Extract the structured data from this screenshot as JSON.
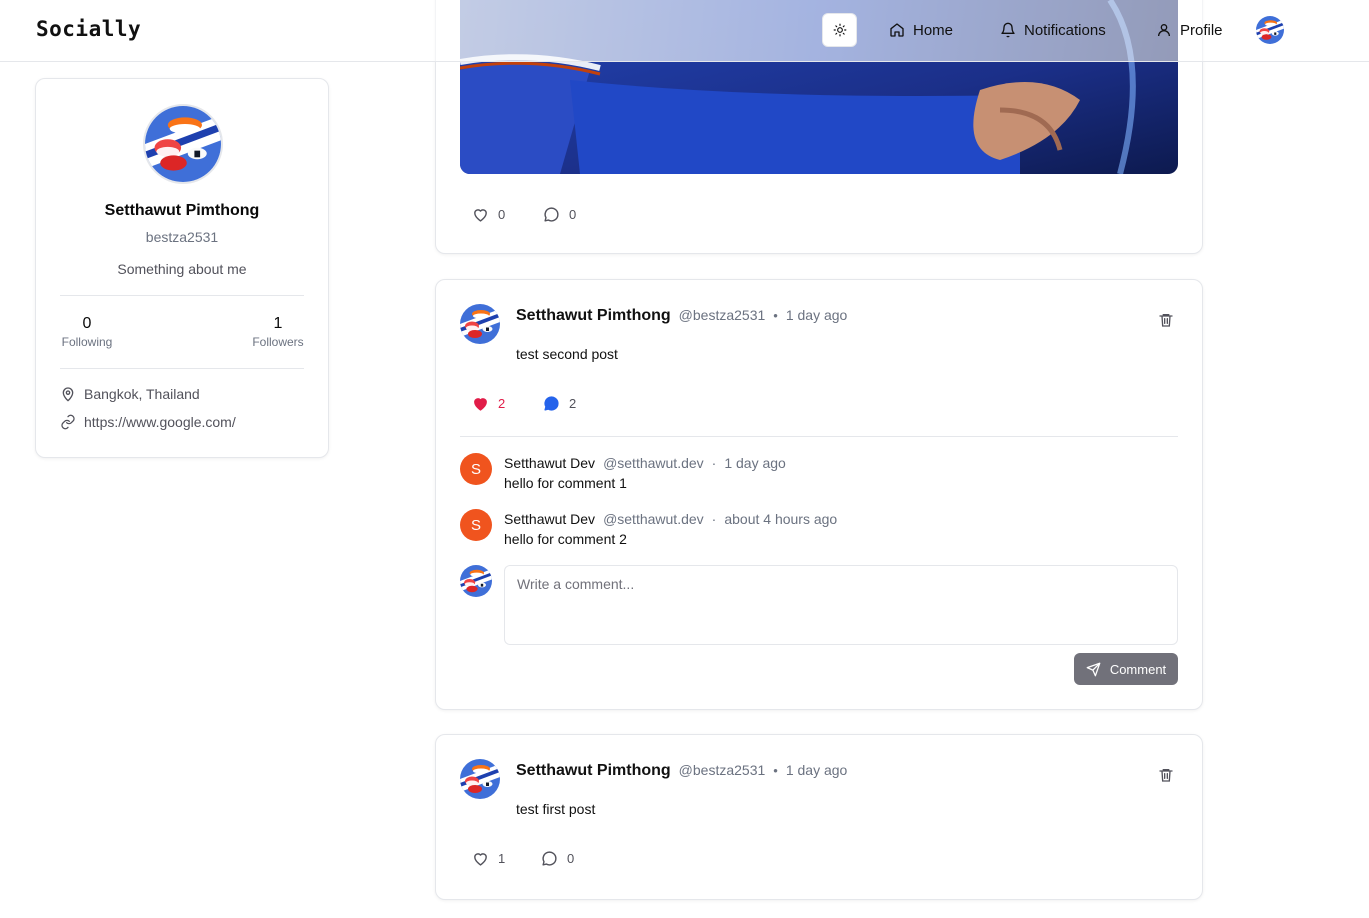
{
  "app": {
    "name": "Socially"
  },
  "nav": {
    "home": "Home",
    "notifications": "Notifications",
    "profile": "Profile"
  },
  "profile": {
    "name": "Setthawut Pimthong",
    "username": "bestza2531",
    "bio": "Something about me",
    "following_count": "0",
    "following_label": "Following",
    "followers_count": "1",
    "followers_label": "Followers",
    "location": "Bangkok, Thailand",
    "website": "https://www.google.com/"
  },
  "top_post": {
    "likes": "0",
    "comments": "0"
  },
  "posts": [
    {
      "author": "Setthawut Pimthong",
      "handle": "@bestza2531",
      "time": "1 day ago",
      "text": "test second post",
      "likes": "2",
      "comments_count": "2",
      "comments": [
        {
          "avatar_letter": "S",
          "author": "Setthawut Dev",
          "handle": "@setthawut.dev",
          "time": "1 day ago",
          "text": "hello for comment 1"
        },
        {
          "avatar_letter": "S",
          "author": "Setthawut Dev",
          "handle": "@setthawut.dev",
          "time": "about 4 hours ago",
          "text": "hello for comment 2"
        }
      ],
      "comment_placeholder": "Write a comment...",
      "comment_button": "Comment"
    },
    {
      "author": "Setthawut Pimthong",
      "handle": "@bestza2531",
      "time": "1 day ago",
      "text": "test first post",
      "likes": "1",
      "comments_count": "0"
    }
  ],
  "colors": {
    "like_active": "#e11d48",
    "comment_active": "#2563eb",
    "comment_avatar": "#f0541e",
    "comment_button": "#71717a"
  }
}
